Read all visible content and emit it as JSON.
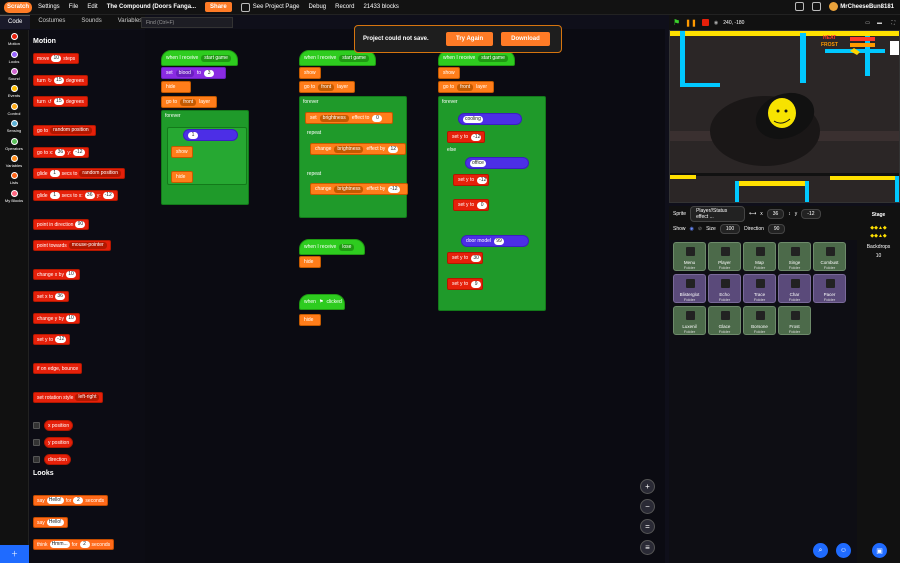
{
  "menu": {
    "logo": "Scratch",
    "settings": "Settings",
    "file": "File",
    "edit": "Edit",
    "project_title": "The Compound (Doors Fanga...",
    "share": "Share",
    "see_project": "See Project Page",
    "debug": "Debug",
    "record": "Record",
    "block_count": "21433 blocks",
    "username": "MrCheeseBun8181"
  },
  "tabs": {
    "code": "Code",
    "costumes": "Costumes",
    "sounds": "Sounds",
    "variables": "Variables"
  },
  "find_placeholder": "Find (Ctrl+F)",
  "categories": [
    {
      "label": "Motion",
      "color": "#e6200a"
    },
    {
      "label": "Looks",
      "color": "#9966ff"
    },
    {
      "label": "Sound",
      "color": "#cf63cf"
    },
    {
      "label": "Events",
      "color": "#ffbf00"
    },
    {
      "label": "Control",
      "color": "#ffab19"
    },
    {
      "label": "Sensing",
      "color": "#5cb1d6"
    },
    {
      "label": "Operators",
      "color": "#59c059"
    },
    {
      "label": "Variables",
      "color": "#ff8c1a"
    },
    {
      "label": "Lists",
      "color": "#ff661a"
    },
    {
      "label": "My Blocks",
      "color": "#ff6680"
    }
  ],
  "palette": {
    "motion_title": "Motion",
    "looks_title": "Looks",
    "move": "move",
    "move_val": "10",
    "steps": "steps",
    "turn_right": "turn",
    "turn_right_val": "15",
    "degrees": "degrees",
    "turn_left": "turn",
    "turn_left_val": "15",
    "goto": "go to",
    "goto_drop": "random position",
    "goto_xy": "go to x:",
    "goto_x": "36",
    "y": "y:",
    "goto_y": "-12",
    "glide1": "glide",
    "glide1_val": "1",
    "glide1_mid": "secs to",
    "glide1_drop": "random position",
    "glide2": "glide",
    "glide2_val": "1",
    "glide2_mid": "secs to x:",
    "glide2_x": "36",
    "glide2_y": "-12",
    "point_dir": "point in direction",
    "point_dir_val": "90",
    "point_towards": "point towards",
    "point_towards_drop": "mouse-pointer",
    "change_x": "change x by",
    "change_x_val": "10",
    "set_x": "set x to",
    "set_x_val": "36",
    "change_y": "change y by",
    "change_y_val": "10",
    "set_y": "set y to",
    "set_y_val": "-12",
    "bounce": "if on edge, bounce",
    "rot_style": "set rotation style",
    "rot_style_drop": "left-right",
    "x_pos": "x position",
    "y_pos": "y position",
    "direction": "direction",
    "say_for": "say",
    "say_for_val": "Hello!",
    "for": "for",
    "say_for_secs": "2",
    "seconds": "seconds",
    "say": "say",
    "say_val": "Hello!",
    "think_for": "think",
    "think_for_val": "Hmm...",
    "think_for_secs": "2"
  },
  "alert": {
    "message": "Project could not save.",
    "try_again": "Try Again",
    "download": "Download"
  },
  "scripts": {
    "when_receive": "when I receive",
    "start_game": "start game",
    "set": "set",
    "blood": "blood",
    "to": "to",
    "blood_val": "3",
    "hide": "hide",
    "show": "show",
    "go_to": "go to",
    "front": "front",
    "layer": "layer",
    "forever": "forever",
    "if": "if",
    "then": "then",
    "else": "else",
    "if_val": "1",
    "brightness": "brightness",
    "effect_to": "effect to",
    "bright_val": "0",
    "repeat": "repeat",
    "repeat_val": "5",
    "change": "change",
    "effect_by": "effect by",
    "change_val1": "12",
    "change_val2": "-12",
    "when_receive_lose": "lose",
    "when_flag": "when",
    "clicked": "clicked",
    "cooling": "cooling",
    "office": "office",
    "door_model": "door model",
    "door_val": "99",
    "set_y": "set y to",
    "y12": "-12",
    "y0": "0",
    "y30": "30",
    "y9": "9"
  },
  "stage_bar": {
    "coords": "240, -180"
  },
  "stage_hud": {
    "heat": "HEAT",
    "frost": "FROST"
  },
  "sprite_info": {
    "sprite_label": "Sprite",
    "sprite_name": "Player//Status effect ...",
    "x_label": "x",
    "x_val": "36",
    "y_label": "y",
    "y_val": "-12",
    "show_label": "Show",
    "size_label": "Size",
    "size_val": "100",
    "direction_label": "Direction",
    "direction_val": "90"
  },
  "sprites": [
    {
      "name": "Menu",
      "sub": "Folder"
    },
    {
      "name": "Player",
      "sub": "Folder"
    },
    {
      "name": "Map",
      "sub": "Folder"
    },
    {
      "name": "Singe",
      "sub": "Folder"
    },
    {
      "name": "Combust",
      "sub": "Folder"
    },
    {
      "name": "Blisterglot",
      "sub": "Folder"
    },
    {
      "name": "Echo",
      "sub": "Folder"
    },
    {
      "name": "Trace",
      "sub": "Folder"
    },
    {
      "name": "Char",
      "sub": "Folder"
    },
    {
      "name": "Pacer",
      "sub": "Folder"
    },
    {
      "name": "Luxenil",
      "sub": "Folder"
    },
    {
      "name": "Glace",
      "sub": "Folder"
    },
    {
      "name": "Borsone",
      "sub": "Folder"
    },
    {
      "name": "Frost",
      "sub": "Folder"
    }
  ],
  "stage_panel": {
    "title": "Stage",
    "backdrops": "Backdrops",
    "backdrops_count": "10"
  }
}
